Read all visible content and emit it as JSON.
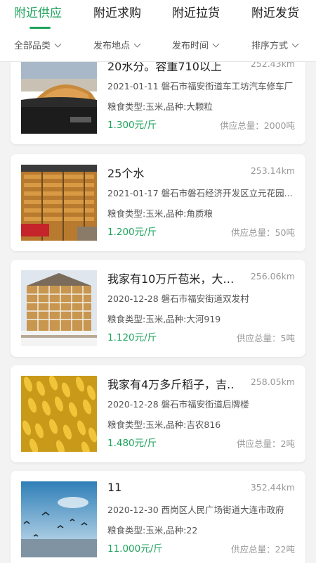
{
  "tabs": [
    {
      "label": "附近供应",
      "active": true
    },
    {
      "label": "附近求购",
      "active": false
    },
    {
      "label": "附近拉货",
      "active": false
    },
    {
      "label": "附近发货",
      "active": false
    }
  ],
  "filters": [
    {
      "label": "全部品类"
    },
    {
      "label": "发布地点"
    },
    {
      "label": "发布时间"
    },
    {
      "label": "排序方式"
    }
  ],
  "colors": {
    "accent": "#1fa35c",
    "background": "#f3f3f3"
  },
  "listings": [
    {
      "title": "20水分。容重710以上",
      "distance": "252.43km",
      "date_address": "2021-01-11 磐石市福安街道车工坊汽车修车厂",
      "grain": "粮食类型:玉米,品种:大颗粒",
      "price": "1.300元/斤",
      "supply": "供应总量：2000吨",
      "image": "corn-pile-photo"
    },
    {
      "title": "25个水",
      "distance": "253.14km",
      "date_address": "2021-01-17 磐石市磐石经济开发区立元花园...",
      "grain": "粮食类型:玉米,品种:角质粮",
      "price": "1.200元/斤",
      "supply": "供应总量：50吨",
      "image": "corn-crib-photo"
    },
    {
      "title": "我家有10万斤苞米，大部..",
      "distance": "256.06km",
      "date_address": "2020-12-28 磐石市福安街道双发村",
      "grain": "粮食类型:玉米,品种:大河919",
      "price": "1.120元/斤",
      "supply": "供应总量：5吨",
      "image": "corn-storage-rack-photo"
    },
    {
      "title": "我家有4万多斤稻子，吉..",
      "distance": "258.05km",
      "date_address": "2020-12-28 磐石市福安街道后牌楼",
      "grain": "粮食类型:玉米,品种:吉农816",
      "price": "1.480元/斤",
      "supply": "供应总量：2吨",
      "image": "rice-grain-photo"
    },
    {
      "title": "11",
      "distance": "352.44km",
      "date_address": "2020-12-30 西岗区人民广场街道大连市政府",
      "grain": "粮食类型:玉米,品种:22",
      "price": "11.000元/斤",
      "supply": "供应总量：22吨",
      "image": "seagulls-sea-photo"
    }
  ]
}
